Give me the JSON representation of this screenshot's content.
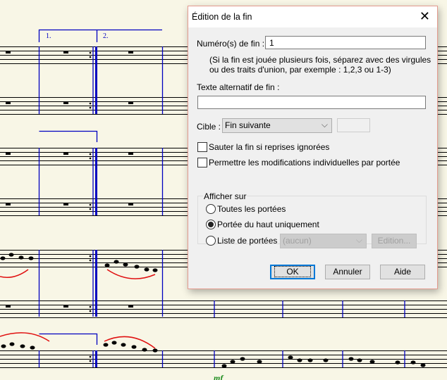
{
  "score": {
    "ending_1": "1.",
    "ending_2": "2.",
    "dynamic": "mf"
  },
  "dialog": {
    "title": "Édition de la fin",
    "close_icon": "close-icon",
    "ending_numbers_label": "Numéro(s) de fin :",
    "ending_numbers_value": "1",
    "hint_line1": "(Si la fin est jouée plusieurs fois, séparez avec des virgules",
    "hint_line2": "ou des traits d'union, par exemple : 1,2,3 ou 1-3)",
    "alt_text_label": "Texte alternatif de fin :",
    "alt_text_value": "",
    "target_label": "Cible :",
    "target_value": "Fin suivante",
    "skip_checkbox_label": "Sauter la fin si reprises ignorées",
    "skip_checked": false,
    "allow_checkbox_label": "Permettre les modifications individuelles par portée",
    "allow_checked": false,
    "show_on_group": "Afficher sur",
    "radio_all": "Toutes les portées",
    "radio_top": "Portée du haut uniquement",
    "radio_list": "Liste de portées :",
    "selected_radio": "radio_top",
    "staff_list_value": "(aucun)",
    "edit_button": "Edition...",
    "ok_button": "OK",
    "cancel_button": "Annuler",
    "help_button": "Aide"
  },
  "colors": {
    "barline": "#0000c0",
    "slur": "#e01010",
    "dialog_border": "#e49a8e",
    "focus": "#0078d7"
  }
}
